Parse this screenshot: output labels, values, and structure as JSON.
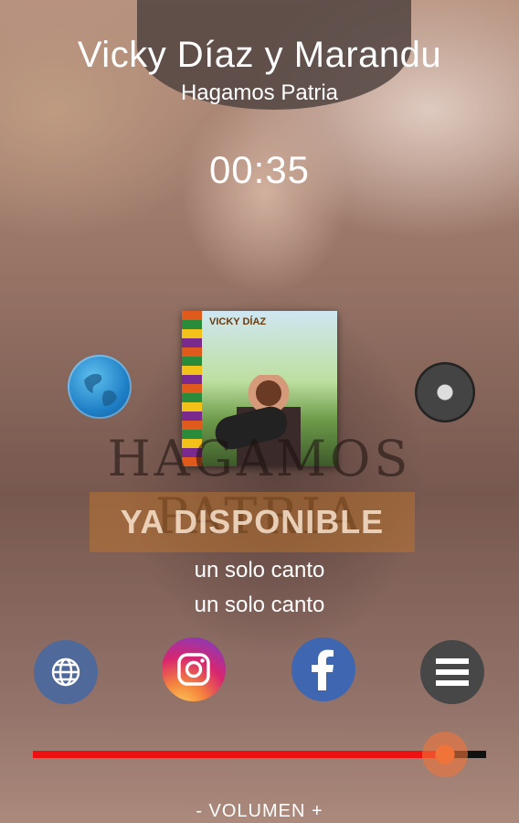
{
  "player": {
    "artist": "Vicky Díaz y Marandu",
    "song": "Hagamos Patria",
    "time": "00:35",
    "progress_fraction": 0.91
  },
  "album": {
    "cover_label": "VICKY DÍAZ"
  },
  "promo": {
    "title": "HAGAMOS PATRIA",
    "badge": "YA DISPONIBLE"
  },
  "lyrics": {
    "line1": "un solo canto",
    "line2": "un solo canto"
  },
  "actions": {
    "web_icon": "globe-icon",
    "instagram_icon": "instagram-icon",
    "facebook_icon": "facebook-icon",
    "menu_icon": "menu-icon"
  },
  "volume": {
    "label": "- VOLUMEN +"
  },
  "colors": {
    "progress": "#ee1111",
    "knob": "#f0743a",
    "facebook": "#3f67b1",
    "menu": "#474747"
  }
}
